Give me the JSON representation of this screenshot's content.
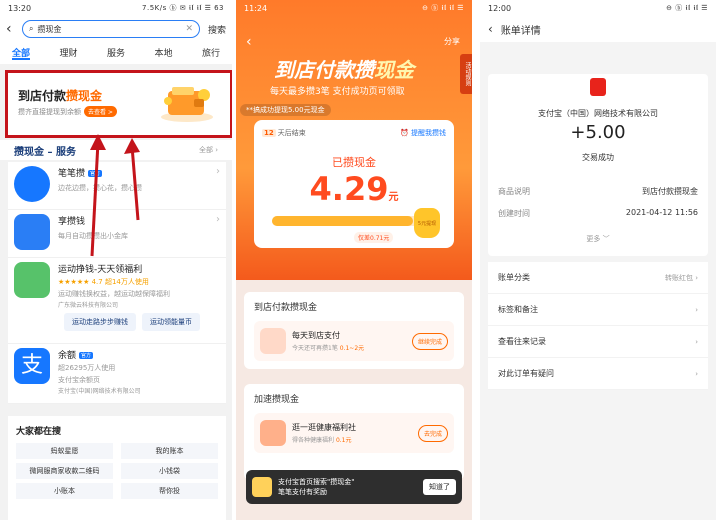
{
  "panel1": {
    "status": {
      "time": "13:20",
      "right": "7.5K/s ⓑ ✉ 𝖎𝖑 𝖎𝖑 ☰ 63"
    },
    "search": {
      "back": "‹",
      "query": "攒现金",
      "clear": "✕",
      "button": "搜索"
    },
    "tabs": [
      "全部",
      "理财",
      "服务",
      "本地",
      "旅行"
    ],
    "banner": {
      "title_a": "到店付款",
      "title_b": "攒现金",
      "sub": "攒齐直接提现到余额",
      "cta": "去查看 >"
    },
    "section": {
      "title": "攒现金 – 服务",
      "all": "全部 ›"
    },
    "services": [
      {
        "name": "笔笔攒",
        "badge": "官方",
        "desc": "边花边攒，攒心花，攒心攒"
      },
      {
        "name": "享攒钱",
        "badge": "",
        "desc": "每月自动攒攒出小金库"
      },
      {
        "name": "运动挣钱-天天领福利",
        "badge": "",
        "desc": "运动赚钱换权益，越运动越保障福利",
        "rating": "★★★★★ 4.7 超14万人使用",
        "org": "广东微云科技有限公司",
        "pills": [
          "运动走路步步赚钱",
          "运动领能量币"
        ]
      },
      {
        "name": "余额",
        "badge": "官方",
        "desc": "支付宝余额页",
        "rating": "超26295万人使用",
        "org": "支付宝(中国)网络技术有限公司"
      }
    ],
    "hot": {
      "title": "大家都在搜",
      "items": [
        "蚂蚁星愿",
        "我的账本",
        "微网服商家收款二维码",
        "小钱袋",
        "小账本",
        "帮你投"
      ]
    }
  },
  "panel2": {
    "status": {
      "time": "11:24",
      "right": "⊖ ⓑ 𝖎𝖑 𝖎𝖑 ☰"
    },
    "back": "‹",
    "share": "分享",
    "rule": "活动规则",
    "title_a": "到店付款攒",
    "title_b": "现金",
    "sub": "每天最多攒3笔 支付成功页可领取",
    "tip": "**搞成功提现5.00元现金",
    "card": {
      "days": "12",
      "days_label": "天后结束",
      "remind": "⏰ 提醒我攒钱",
      "label": "已攒现金",
      "amount": "4.29",
      "unit": "元",
      "bag": "5元提现",
      "rest": "仅差0.71元",
      "progress": 0.86
    },
    "sec1": {
      "title": "到店付款攒现金",
      "task": {
        "name": "每天到店支付",
        "desc_a": "今天还可再攒1笔",
        "desc_b": "0.1~2元",
        "btn": "继续完成"
      }
    },
    "sec2": {
      "title": "加速攒现金",
      "task": {
        "name": "逛一逛健康福利社",
        "desc_a": "得各种健康福利",
        "desc_b": "0.1元",
        "btn": "去完成"
      }
    },
    "toast": {
      "line1": "支付宝首页搜索\"攒现金\"",
      "line2": "笔笔支付有奖励",
      "ok": "知道了"
    }
  },
  "panel3": {
    "status": {
      "time": "12:00",
      "right": "⊖ ⓑ 𝖎𝖑 𝖎𝖑 ☰"
    },
    "back": "‹",
    "title": "账单详情",
    "company": "支付宝（中国）网络技术有限公司",
    "amount": "+5.00",
    "state": "交易成功",
    "rows": [
      {
        "k": "商品说明",
        "v": "到店付款攒现金"
      },
      {
        "k": "创建时间",
        "v": "2021-04-12 11:56"
      }
    ],
    "more": "更多 ﹀",
    "list": [
      {
        "label": "账单分类",
        "value": "转账红包 ›"
      },
      {
        "label": "标签和备注",
        "value": "›"
      },
      {
        "label": "查看往来记录",
        "value": "›"
      },
      {
        "label": "对此订单有疑问",
        "value": "›"
      }
    ]
  }
}
